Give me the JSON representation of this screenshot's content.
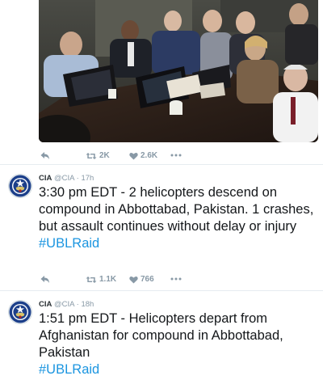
{
  "top_tweet": {
    "retweets": "2K",
    "likes": "2.6K"
  },
  "tweets": [
    {
      "name": "CIA",
      "handle": "@CIA",
      "sep": "·",
      "time": "17h",
      "text": "3:30 pm EDT - 2 helicopters descend on compound in Abbottabad, Pakistan. 1 crashes, but assault continues without delay or injury",
      "hashtag": "#UBLRaid",
      "retweets": "1.1K",
      "likes": "766"
    },
    {
      "name": "CIA",
      "handle": "@CIA",
      "sep": "·",
      "time": "18h",
      "text": "1:51 pm EDT - Helicopters depart from Afghanistan for compound in Abbottabad, Pakistan",
      "hashtag": "#UBLRaid"
    }
  ],
  "icons": [
    "reply-icon",
    "retweet-icon",
    "like-icon",
    "more-icon",
    "cia-seal-icon"
  ],
  "colors": {
    "text": "#14171a",
    "muted": "#8899a6",
    "hashtag": "#1b95e0",
    "divider": "#e6ecf0",
    "seal_blue": "#1c3f8a"
  }
}
